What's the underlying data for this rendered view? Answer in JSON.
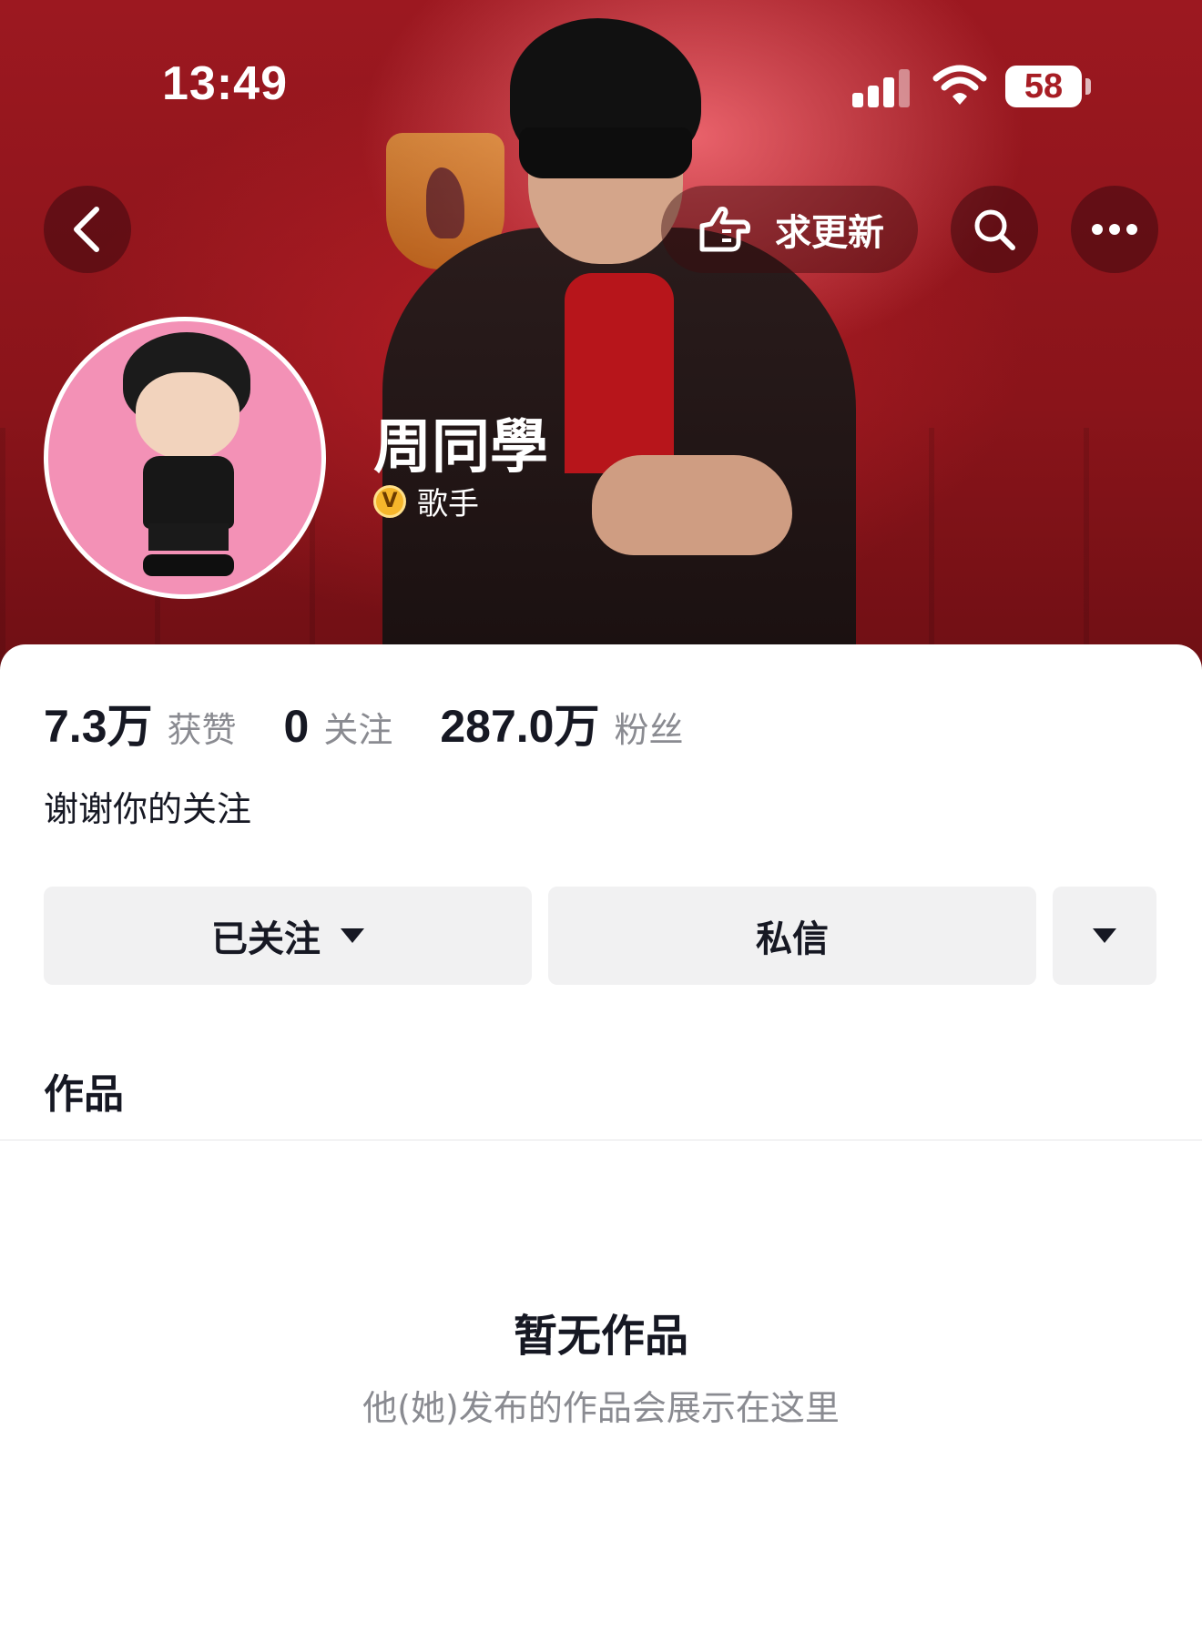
{
  "status_bar": {
    "time": "13:49",
    "battery": "58"
  },
  "top_nav": {
    "back_icon": "chevron-left-icon",
    "request_update_label": "求更新",
    "request_update_icon": "pointing-hand-icon",
    "search_icon": "search-icon",
    "more_icon": "more-dots-icon"
  },
  "profile": {
    "name": "周同學",
    "verified_icon": "verified-v-icon",
    "role": "歌手"
  },
  "stats": [
    {
      "value": "7.3万",
      "label": "获赞"
    },
    {
      "value": "0",
      "label": "关注"
    },
    {
      "value": "287.0万",
      "label": "粉丝"
    }
  ],
  "bio": "谢谢你的关注",
  "actions": {
    "following_label": "已关注",
    "message_label": "私信"
  },
  "tabs": {
    "works_label": "作品"
  },
  "empty_state": {
    "title": "暂无作品",
    "subtitle": "他(她)发布的作品会展示在这里"
  },
  "colors": {
    "cover_red": "#9c1820",
    "button_gray": "#f1f1f2",
    "text_primary": "#161823",
    "text_secondary": "#8a8b91",
    "badge_gold": "#f6b62b"
  }
}
